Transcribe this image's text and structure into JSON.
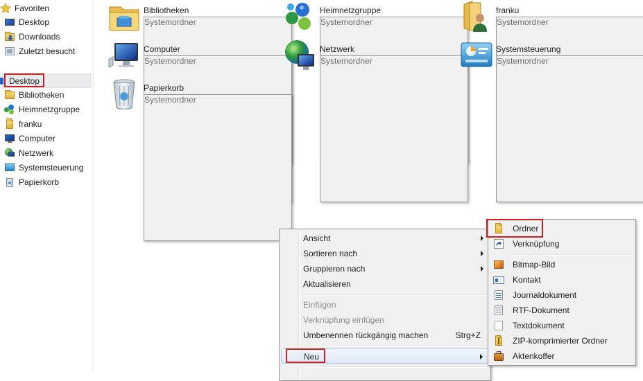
{
  "sidebar": {
    "favorites_header": "Favoriten",
    "favorites": [
      {
        "label": "Desktop",
        "icon": "desktop-icon"
      },
      {
        "label": "Downloads",
        "icon": "downloads-folder-icon"
      },
      {
        "label": "Zuletzt besucht",
        "icon": "recent-places-icon"
      }
    ],
    "desktop_label": "Desktop",
    "tree": [
      {
        "label": "Bibliotheken",
        "icon": "libraries-icon"
      },
      {
        "label": "Heimnetzgruppe",
        "icon": "homegroup-icon"
      },
      {
        "label": "franku",
        "icon": "user-folder-icon"
      },
      {
        "label": "Computer",
        "icon": "computer-icon"
      },
      {
        "label": "Netzwerk",
        "icon": "network-icon"
      },
      {
        "label": "Systemsteuerung",
        "icon": "control-panel-icon"
      },
      {
        "label": "Papierkorb",
        "icon": "recycle-bin-icon"
      }
    ]
  },
  "content": {
    "items": [
      {
        "name": "Bibliotheken",
        "type": "Systemordner"
      },
      {
        "name": "Heimnetzgruppe",
        "type": "Systemordner"
      },
      {
        "name": "franku",
        "type": "Systemordner"
      },
      {
        "name": "Computer",
        "type": "Systemordner"
      },
      {
        "name": "Netzwerk",
        "type": "Systemordner"
      },
      {
        "name": "Systemsteuerung",
        "type": "Systemordner"
      },
      {
        "name": "Papierkorb",
        "type": "Systemordner"
      }
    ]
  },
  "context_menu": {
    "ansicht": "Ansicht",
    "sortieren": "Sortieren nach",
    "gruppieren": "Gruppieren nach",
    "aktualisieren": "Aktualisieren",
    "einfuegen": "Einfügen",
    "verknuepfung_einfuegen": "Verknüpfung einfügen",
    "umbenennen": "Umbenennen rückgängig machen",
    "umbenennen_shortcut": "Strg+Z",
    "neu": "Neu"
  },
  "submenu": {
    "ordner": "Ordner",
    "verknuepfung": "Verknüpfung",
    "bitmap": "Bitmap-Bild",
    "kontakt": "Kontakt",
    "journal": "Journaldokument",
    "rtf": "RTF-Dokument",
    "text": "Textdokument",
    "zip": "ZIP-komprimierter Ordner",
    "aktenkoffer": "Aktenkoffer"
  },
  "colors": {
    "highlight_frame": "#cc1f1f",
    "menu_background": "#f0f0f0",
    "menu_hover": "#dde8f5",
    "secondary_text": "#6d6d6d"
  }
}
